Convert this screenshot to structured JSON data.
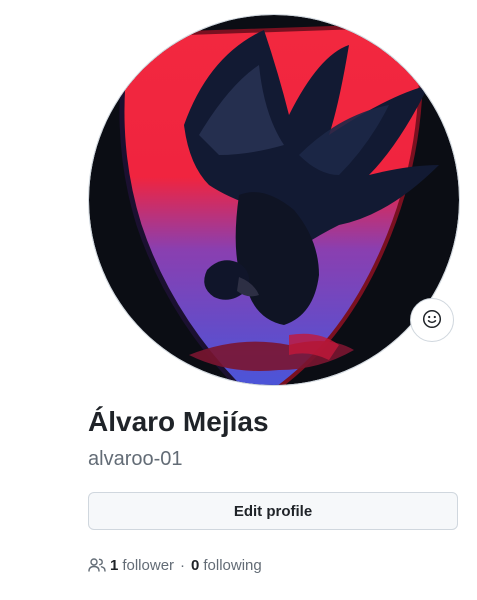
{
  "profile": {
    "display_name": "Álvaro Mejías",
    "username": "alvaroo-01",
    "edit_button_label": "Edit profile",
    "avatar_alt": "alvaroo-01 avatar",
    "status_icon": "smiley-icon"
  },
  "social": {
    "people_icon": "people-icon",
    "followers_count": "1",
    "followers_label": "follower",
    "separator": "·",
    "following_count": "0",
    "following_label": "following"
  },
  "colors": {
    "avatar_red": "#f2283f",
    "avatar_purple": "#8a3fb0",
    "avatar_blue": "#4a55d9",
    "avatar_dark": "#0b0d14",
    "button_bg": "#f6f8fa",
    "muted_text": "#636c76"
  }
}
